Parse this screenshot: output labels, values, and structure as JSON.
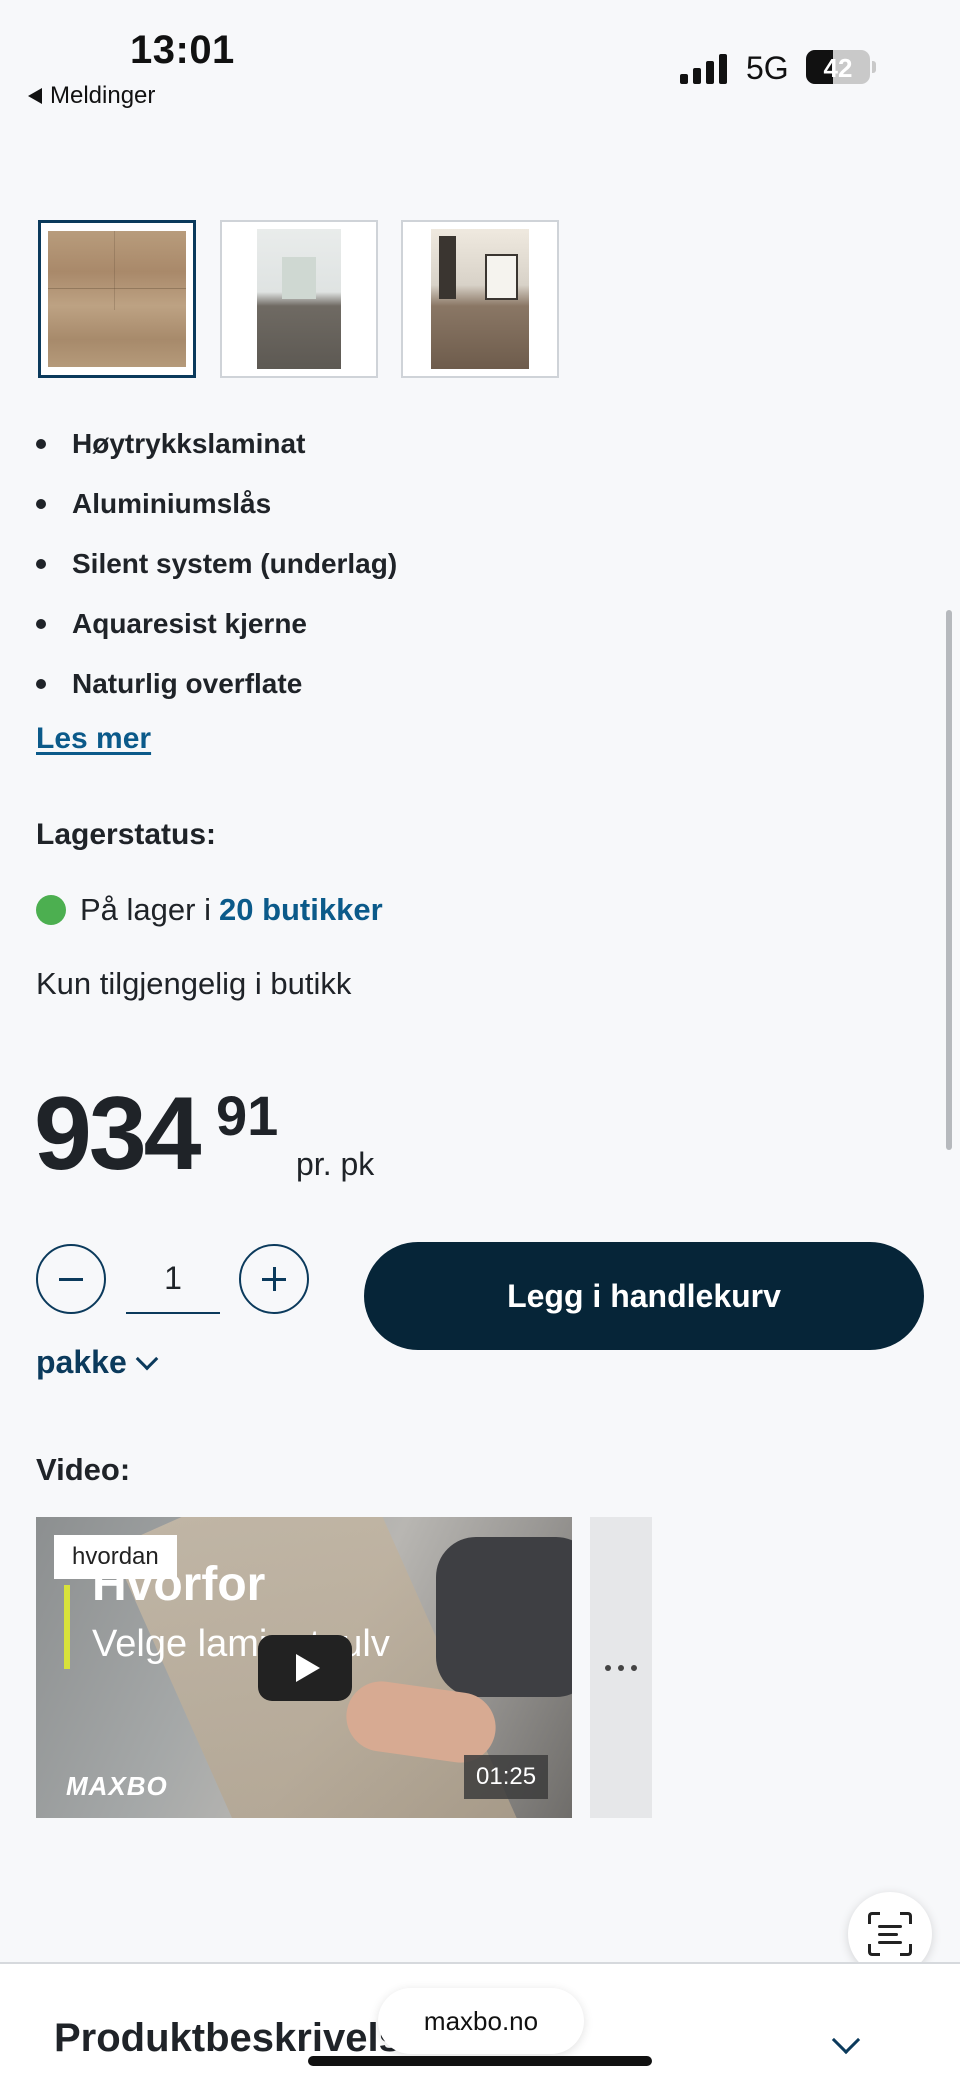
{
  "status_bar": {
    "time": "13:01",
    "back_label": "Meldinger",
    "network": "5G",
    "battery": "42"
  },
  "gallery": {
    "thumbnails": [
      {
        "label": "laminate-plank-closeup"
      },
      {
        "label": "hallway-interior"
      },
      {
        "label": "living-room-interior"
      }
    ]
  },
  "features": [
    "Høytrykkslaminat",
    "Aluminiumslås",
    "Silent system (underlag)",
    "Aquaresist kjerne",
    "Naturlig overflate"
  ],
  "read_more": "Les mer",
  "stock": {
    "title": "Lagerstatus:",
    "prefix": "På lager i",
    "link": "20 butikker",
    "availability": "Kun tilgjengelig i butikk",
    "status_color": "#4caf50"
  },
  "price": {
    "integer": "934",
    "decimals": "91",
    "unit": "pr. pk"
  },
  "quantity": {
    "value": "1",
    "unit_select": "pakke"
  },
  "cart_button": "Legg i handlekurv",
  "video": {
    "title": "Video:",
    "tag": "hvordan",
    "heading": "Hvorfor",
    "subheading": "Velge laminatgulv",
    "brand": "MAXBO",
    "duration": "01:25"
  },
  "bottom": {
    "section_title": "Produktbeskrivelse",
    "url": "maxbo.no"
  },
  "colors": {
    "primary_dark": "#062538",
    "link": "#0b5a8a",
    "accent_green": "#4caf50"
  }
}
